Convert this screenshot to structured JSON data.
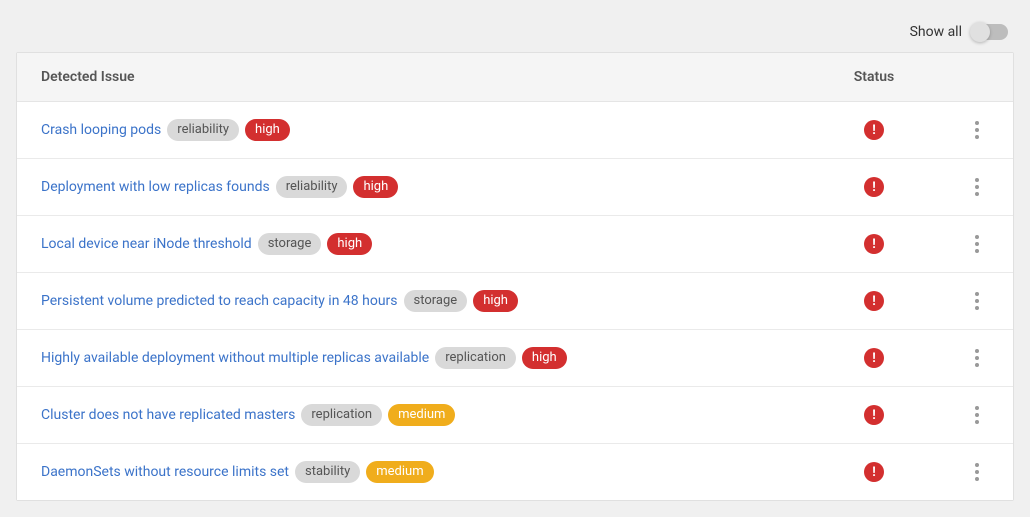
{
  "toolbar": {
    "show_all_label": "Show all",
    "show_all_on": false
  },
  "table": {
    "headers": {
      "issue": "Detected Issue",
      "status": "Status"
    },
    "rows": [
      {
        "title": "Crash looping pods",
        "category": "reliability",
        "severity": "high",
        "status": "alert"
      },
      {
        "title": "Deployment with low replicas founds",
        "category": "reliability",
        "severity": "high",
        "status": "alert"
      },
      {
        "title": "Local device near iNode threshold",
        "category": "storage",
        "severity": "high",
        "status": "alert"
      },
      {
        "title": "Persistent volume predicted to reach capacity in 48 hours",
        "category": "storage",
        "severity": "high",
        "status": "alert"
      },
      {
        "title": "Highly available deployment without multiple replicas available",
        "category": "replication",
        "severity": "high",
        "status": "alert"
      },
      {
        "title": "Cluster does not have replicated masters",
        "category": "replication",
        "severity": "medium",
        "status": "alert"
      },
      {
        "title": "DaemonSets without resource limits set",
        "category": "stability",
        "severity": "medium",
        "status": "alert"
      }
    ]
  },
  "colors": {
    "link": "#3b73c9",
    "danger": "#d32f2f",
    "warning": "#f0ad1c",
    "tag": "#d9d9d9"
  }
}
